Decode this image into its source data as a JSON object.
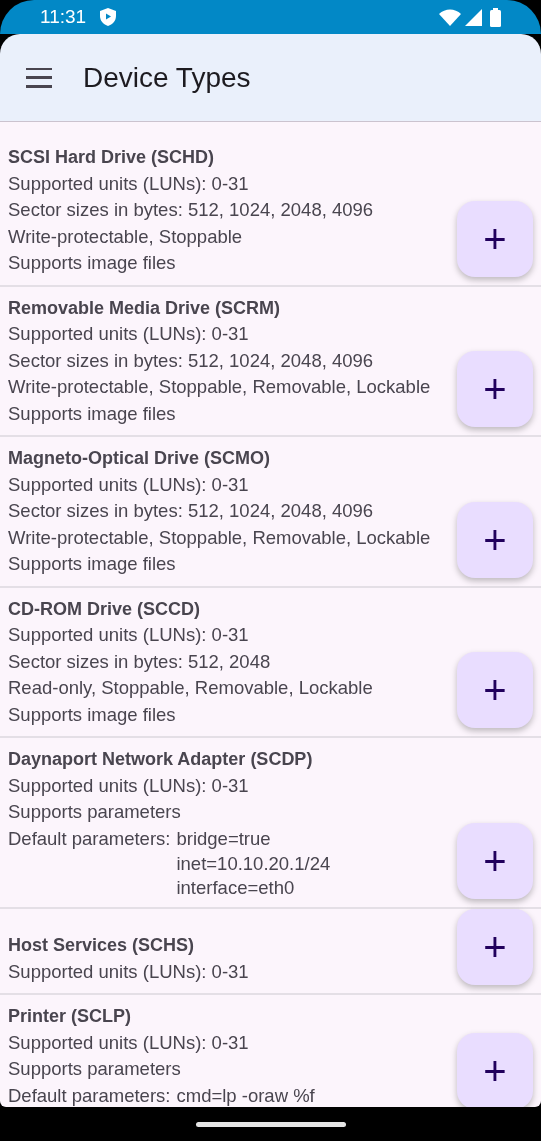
{
  "status_bar": {
    "time": "11:31"
  },
  "app_bar": {
    "title": "Device Types"
  },
  "devices": [
    {
      "title": "SCSI Hard Drive (SCHD)",
      "lines": [
        {
          "kind": "text",
          "text": "Supported units (LUNs): 0-31"
        },
        {
          "kind": "text",
          "text": "Sector sizes in bytes: 512, 1024, 2048, 4096"
        },
        {
          "kind": "text",
          "text": "Write-protectable, Stoppable"
        },
        {
          "kind": "text",
          "text": "Supports image files"
        }
      ],
      "add_button": "+"
    },
    {
      "title": "Removable Media Drive (SCRM)",
      "lines": [
        {
          "kind": "text",
          "text": "Supported units (LUNs): 0-31"
        },
        {
          "kind": "text",
          "text": "Sector sizes in bytes: 512, 1024, 2048, 4096"
        },
        {
          "kind": "text",
          "text": "Write-protectable, Stoppable, Removable, Lockable"
        },
        {
          "kind": "text",
          "text": "Supports image files"
        }
      ],
      "add_button": "+"
    },
    {
      "title": "Magneto-Optical Drive (SCMO)",
      "lines": [
        {
          "kind": "text",
          "text": "Supported units (LUNs): 0-31"
        },
        {
          "kind": "text",
          "text": "Sector sizes in bytes: 512, 1024, 2048, 4096"
        },
        {
          "kind": "text",
          "text": "Write-protectable, Stoppable, Removable, Lockable"
        },
        {
          "kind": "text",
          "text": "Supports image files"
        }
      ],
      "add_button": "+"
    },
    {
      "title": "CD-ROM Drive (SCCD)",
      "lines": [
        {
          "kind": "text",
          "text": "Supported units (LUNs): 0-31"
        },
        {
          "kind": "text",
          "text": "Sector sizes in bytes: 512, 2048"
        },
        {
          "kind": "text",
          "text": "Read-only, Stoppable, Removable, Lockable"
        },
        {
          "kind": "text",
          "text": "Supports image files"
        }
      ],
      "add_button": "+"
    },
    {
      "title": "Daynaport Network Adapter (SCDP)",
      "lines": [
        {
          "kind": "text",
          "text": "Supported units (LUNs): 0-31"
        },
        {
          "kind": "text",
          "text": "Supports parameters"
        },
        {
          "kind": "params",
          "label": "Default parameters:",
          "values": [
            "bridge=true",
            "inet=10.10.20.1/24",
            "interface=eth0"
          ]
        }
      ],
      "add_button": "+"
    },
    {
      "title": "Host Services (SCHS)",
      "lines": [
        {
          "kind": "text",
          "text": "Supported units (LUNs): 0-31"
        }
      ],
      "add_button": "+"
    },
    {
      "title": "Printer (SCLP)",
      "lines": [
        {
          "kind": "text",
          "text": "Supported units (LUNs): 0-31"
        },
        {
          "kind": "text",
          "text": "Supports parameters"
        },
        {
          "kind": "params",
          "label": "Default parameters:",
          "values": [
            "cmd=lp -oraw %f"
          ]
        }
      ],
      "add_button": "+"
    }
  ]
}
